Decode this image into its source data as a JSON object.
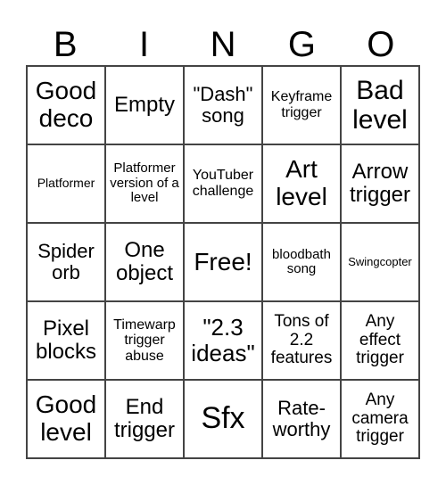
{
  "header": {
    "letters": [
      "B",
      "I",
      "N",
      "G",
      "O"
    ]
  },
  "cells": [
    [
      "Good deco",
      "Empty",
      "\"Dash\" song",
      "Keyframe trigger",
      "Bad level"
    ],
    [
      "Platformer",
      "Platformer version of a level",
      "YouTuber challenge",
      "Art level",
      "Arrow trigger"
    ],
    [
      "Spider orb",
      "One object",
      "Free!",
      "bloodbath song",
      "Swingcopter"
    ],
    [
      "Pixel blocks",
      "Timewarp trigger abuse",
      "\"2.3 ideas\"",
      "Tons of 2.2 features",
      "Any effect trigger"
    ],
    [
      "Good level",
      "End trigger",
      "Sfx",
      "Rate-worthy",
      "Any camera trigger"
    ]
  ]
}
